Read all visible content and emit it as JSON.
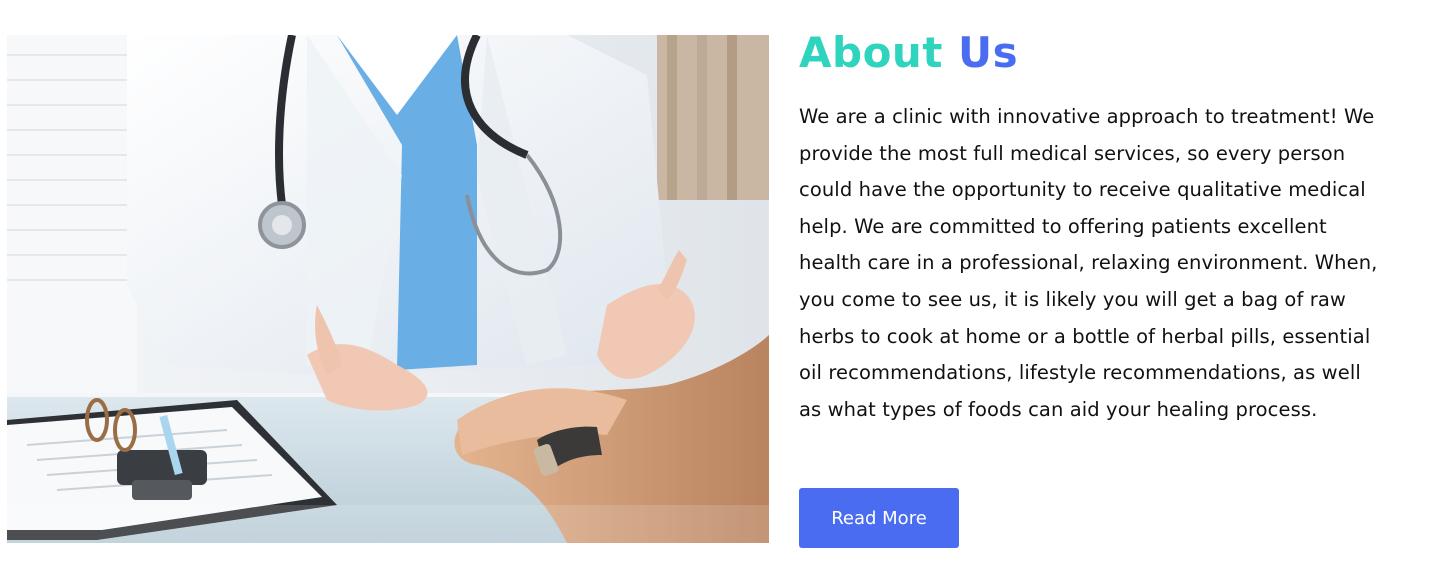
{
  "about": {
    "title_part1": "About",
    "title_part2": "Us",
    "body": "We are a clinic with innovative approach to treatment! We provide the most full medical services, so every person could have the opportunity to receive qualitative medical help. We are committed to offering patients excellent health care in a professional, relaxing environment. When, you come to see us, it is likely you will get a bag of raw herbs to cook at home or a bottle of herbal pills, essential oil recommendations, lifestyle recommendations, as well as what types of foods can aid your healing process.",
    "button_label": "Read More"
  },
  "colors": {
    "title_primary": "#2ed4bd",
    "title_secondary": "#4a6cf0",
    "button_bg": "#4a6cf0",
    "text": "#111111"
  }
}
